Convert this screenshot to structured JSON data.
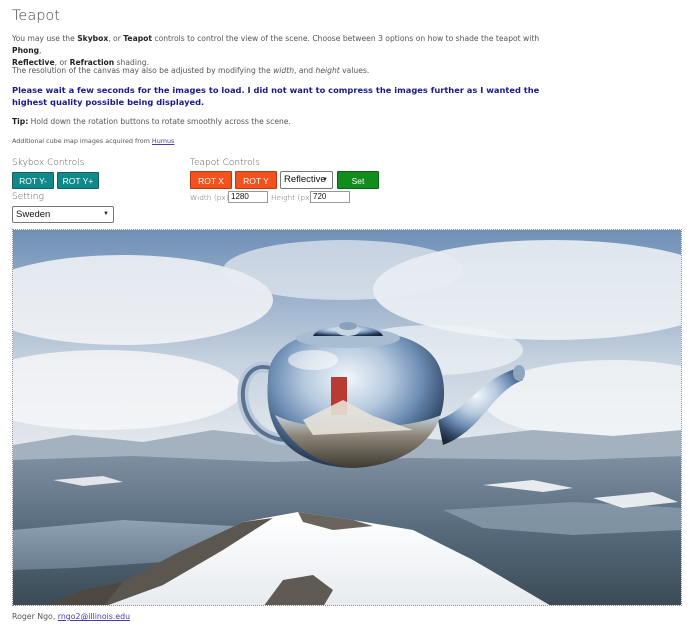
{
  "page": {
    "title": "Teapot",
    "intro": {
      "t1": "You may use the ",
      "skybox": "Skybox",
      "t2": ", or ",
      "teapot": "Teapot",
      "t3": " controls to control the view of the scene. Choose between 3 options on how to shade the teapot with ",
      "phong": "Phong",
      "t4": ", ",
      "reflective": "Reflective",
      "t5": ", or ",
      "refraction": "Refraction",
      "t6": " shading."
    },
    "resolution": {
      "t1": "The resolution of the canvas may also be adjusted by modifying the ",
      "width": "width",
      "t2": ", and ",
      "height": "height",
      "t3": " values."
    },
    "wait_notice": "Please wait a few seconds for the images to load. I did not want to compress the images further as I wanted the highest quality possible being displayed.",
    "tip": {
      "label": "Tip:",
      "text": " Hold down the rotation buttons to rotate smoothly across the scene."
    },
    "credit": {
      "text": "Additional cube map images acquired from ",
      "link": "Humus"
    }
  },
  "skybox_controls": {
    "label": "Skybox Controls",
    "rot_y_minus": "ROT Y-",
    "rot_y_plus": "ROT Y+",
    "setting_label": "Setting",
    "setting_value": "Sweden"
  },
  "teapot_controls": {
    "label": "Teapot Controls",
    "rot_x": "ROT X",
    "rot_y": "ROT Y",
    "shading_value": "Reflective",
    "set": "Set",
    "width_label": "Width (px)",
    "width_value": "1280",
    "height_label": "Height (px)",
    "height_value": "720"
  },
  "footer": {
    "author": "Roger Ngo, ",
    "email": "rngo2@illinois.edu"
  },
  "colors": {
    "teal_button": "#0e8a8a",
    "orange_button": "#f4511e",
    "green_button": "#118c1d",
    "notice_text": "#1a1a8c"
  }
}
